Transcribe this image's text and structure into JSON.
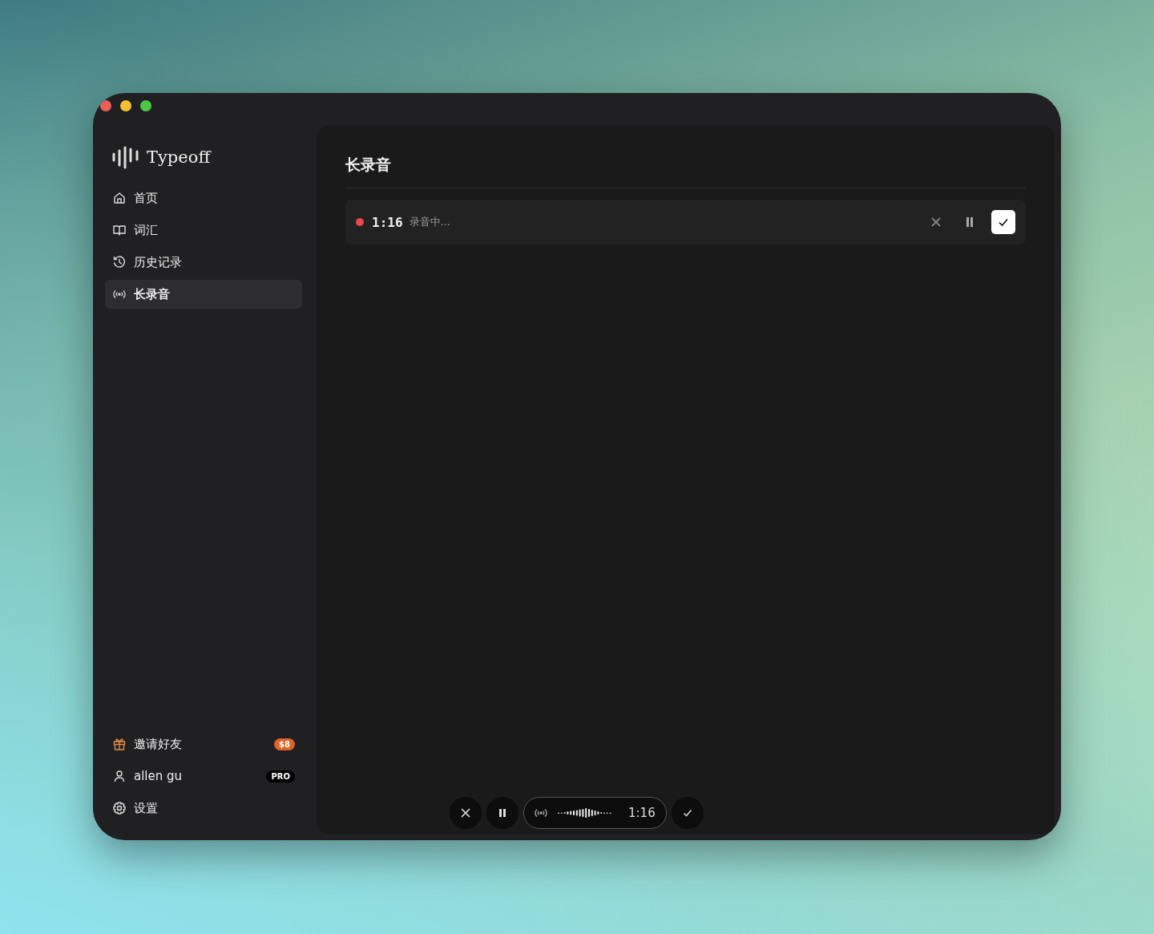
{
  "sidebar": {
    "logo": "Typeoff",
    "items": [
      {
        "label": "首页",
        "selected": false
      },
      {
        "label": "词汇",
        "selected": false
      },
      {
        "label": "历史记录",
        "selected": false
      },
      {
        "label": "长录音",
        "selected": true
      }
    ],
    "footer": [
      {
        "label": "邀请好友",
        "badge": "$8",
        "color": "#e0622a"
      },
      {
        "label": "allen gu",
        "badge": "PRO",
        "color": "#000000"
      },
      {
        "label": "设置"
      }
    ]
  },
  "main": {
    "title": "长录音",
    "recording": {
      "time": "1:16",
      "status": "录音中..."
    },
    "floating_bar": {
      "time": "1:16"
    }
  }
}
